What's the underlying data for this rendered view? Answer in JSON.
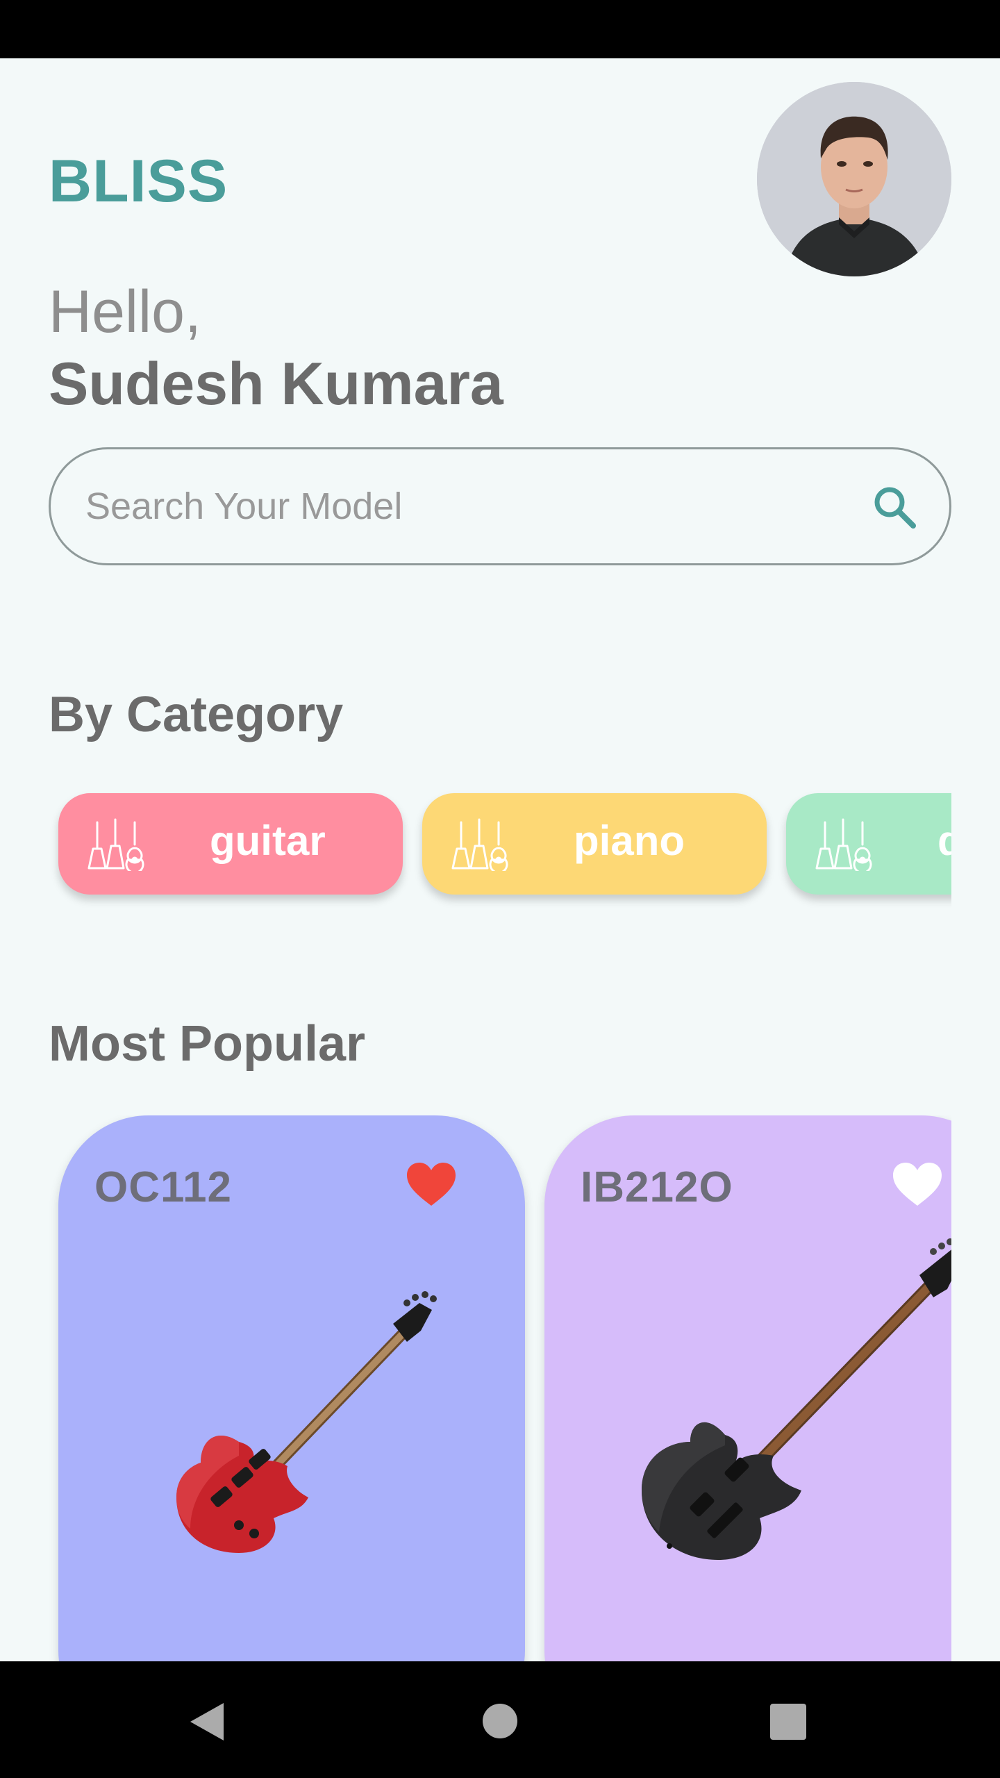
{
  "app": {
    "brand": "BLISS"
  },
  "greeting": {
    "hello": "Hello,",
    "name": "Sudesh Kumara"
  },
  "search": {
    "placeholder": "Search Your Model"
  },
  "categories": {
    "title": "By Category",
    "items": [
      {
        "label": "guitar",
        "color": "#ff8ea0"
      },
      {
        "label": "piano",
        "color": "#fdd875"
      },
      {
        "label": "drums",
        "color": "#a8e9c6"
      }
    ]
  },
  "popular": {
    "title": "Most Popular",
    "items": [
      {
        "name": "OC112",
        "favorited": true,
        "color": "#aab1fb",
        "guitar_color": "red"
      },
      {
        "name": "IB212O",
        "favorited": false,
        "color": "#d6bcfa",
        "guitar_color": "black"
      }
    ]
  },
  "colors": {
    "brand": "#4a9d9a",
    "background": "#f3f9f9",
    "heart_active": "#f0453a"
  }
}
